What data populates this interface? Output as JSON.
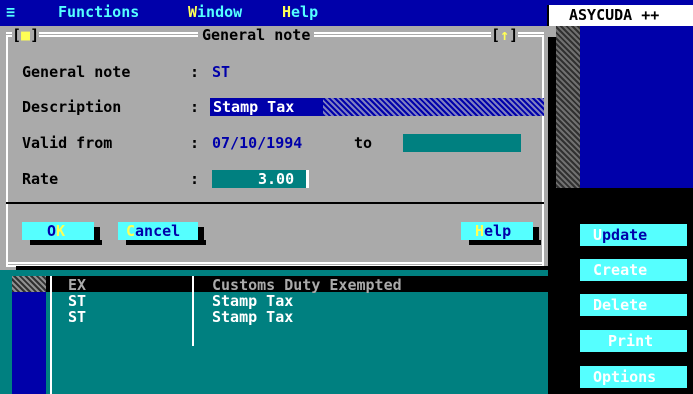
{
  "menubar": {
    "hamburger": "≡",
    "items": [
      {
        "hot": "",
        "rest": "Functions"
      },
      {
        "hot": "W",
        "rest": "indow"
      },
      {
        "hot": "H",
        "rest": "elp"
      }
    ],
    "app_name": "ASYCUDA ++"
  },
  "dialog": {
    "title": "General note",
    "close_box": "[■]",
    "zoom_box": "[↑]",
    "fields": {
      "general_note": {
        "label": "General note",
        "colon": ":",
        "value": "ST"
      },
      "description": {
        "label": "Description",
        "colon": ":",
        "value": "Stamp Tax"
      },
      "valid_from": {
        "label": "Valid from",
        "colon": ":",
        "value": "07/10/1994",
        "to_label": "to",
        "to_value": ""
      },
      "rate": {
        "label": "Rate",
        "colon": ":",
        "value": "3.00"
      }
    },
    "buttons": {
      "ok": {
        "hot": "K",
        "pre": "O",
        "rest": ""
      },
      "cancel": {
        "hot": "C",
        "rest": "ancel"
      },
      "help": {
        "hot": "H",
        "rest": "elp"
      }
    }
  },
  "list": {
    "rows": [
      {
        "code": "EX",
        "description": "Customs Duty Exempted"
      },
      {
        "code": "ST",
        "description": "Stamp Tax"
      },
      {
        "code": "ST",
        "description": "Stamp Tax"
      }
    ]
  },
  "side_buttons": [
    {
      "hot": "U",
      "rest": "pdate"
    },
    {
      "hot": "C",
      "rest": "reate"
    },
    {
      "hot": "D",
      "rest": "elete"
    },
    {
      "hot": "P",
      "rest": "rint"
    },
    {
      "hot": "O",
      "rest": "ptions"
    }
  ],
  "colors": {
    "desktop": "#008080",
    "menubar": "#0000aa",
    "dialog": "#aaaaaa",
    "button": "#55ffff",
    "hotkey": "#ffff55"
  }
}
